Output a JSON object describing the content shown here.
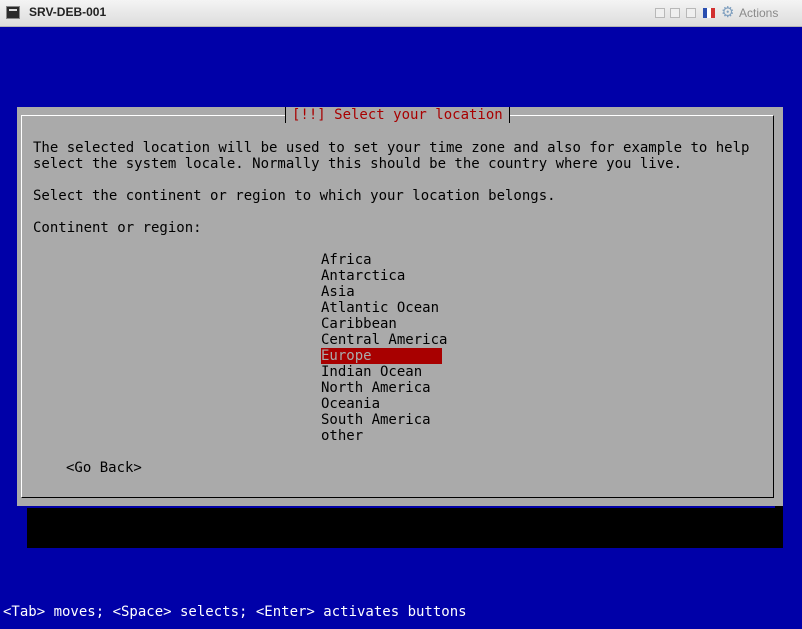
{
  "window": {
    "title": "SRV-DEB-001",
    "actions_label": "Actions",
    "icons": [
      "app-icon",
      "ctrl-alt-del-icon",
      "fullscreen-icon",
      "keyboard-icon",
      "flag-icon",
      "gear-icon"
    ]
  },
  "dialog": {
    "title": "[!!] Select your location",
    "description_line1": "The selected location will be used to set your time zone and also for example to help",
    "description_line2": "select the system locale. Normally this should be the country where you live.",
    "prompt": "Select the continent or region to which your location belongs.",
    "list_label": "Continent or region:",
    "items": [
      "Africa",
      "Antarctica",
      "Asia",
      "Atlantic Ocean",
      "Caribbean",
      "Central America",
      "Europe",
      "Indian Ocean",
      "North America",
      "Oceania",
      "South America",
      "other"
    ],
    "selected": "Europe",
    "go_back_label": "<Go Back>"
  },
  "status_bar": "<Tab> moves; <Space> selects; <Enter> activates buttons",
  "colors": {
    "console_bg": "#0000a8",
    "dialog_bg": "#aaaaaa",
    "title_text": "#a80000",
    "selection_bg": "#a80000",
    "status_text": "#ffffff"
  }
}
